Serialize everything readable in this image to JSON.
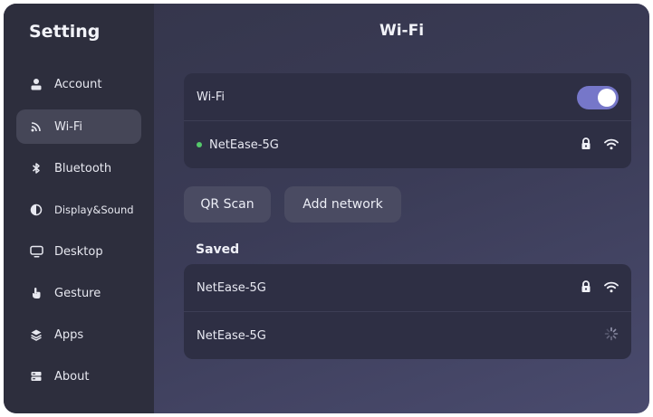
{
  "sidebar": {
    "title": "Setting",
    "items": [
      {
        "label": "Account",
        "icon": "account-icon"
      },
      {
        "label": "Wi-Fi",
        "icon": "wifi-icon",
        "active": true
      },
      {
        "label": "Bluetooth",
        "icon": "bluetooth-icon"
      },
      {
        "label": "Display&Sound",
        "icon": "display-sound-icon"
      },
      {
        "label": "Desktop",
        "icon": "desktop-icon"
      },
      {
        "label": "Gesture",
        "icon": "gesture-icon"
      },
      {
        "label": "Apps",
        "icon": "apps-icon"
      },
      {
        "label": "About",
        "icon": "about-icon"
      }
    ]
  },
  "main": {
    "title": "Wi-Fi",
    "wifi_toggle": {
      "label": "Wi-Fi",
      "on": true
    },
    "connected_network": {
      "name": "NetEase-5G",
      "status_color": "#55c96b",
      "icons": [
        "lock-icon",
        "wifi-signal-icon"
      ]
    },
    "buttons": {
      "qr_scan": "QR Scan",
      "add_network": "Add network"
    },
    "saved": {
      "label": "Saved",
      "networks": [
        {
          "name": "NetEase-5G",
          "icons": [
            "lock-icon",
            "wifi-signal-icon"
          ]
        },
        {
          "name": "NetEase-5G",
          "icons": [
            "loading-spinner-icon"
          ]
        }
      ]
    }
  },
  "colors": {
    "accent": "#7677c9",
    "sidebar_bg": "#2d2e3d",
    "card_bg": "#2e2f44",
    "button_bg": "#4a4b62",
    "connected_dot": "#55c96b"
  }
}
